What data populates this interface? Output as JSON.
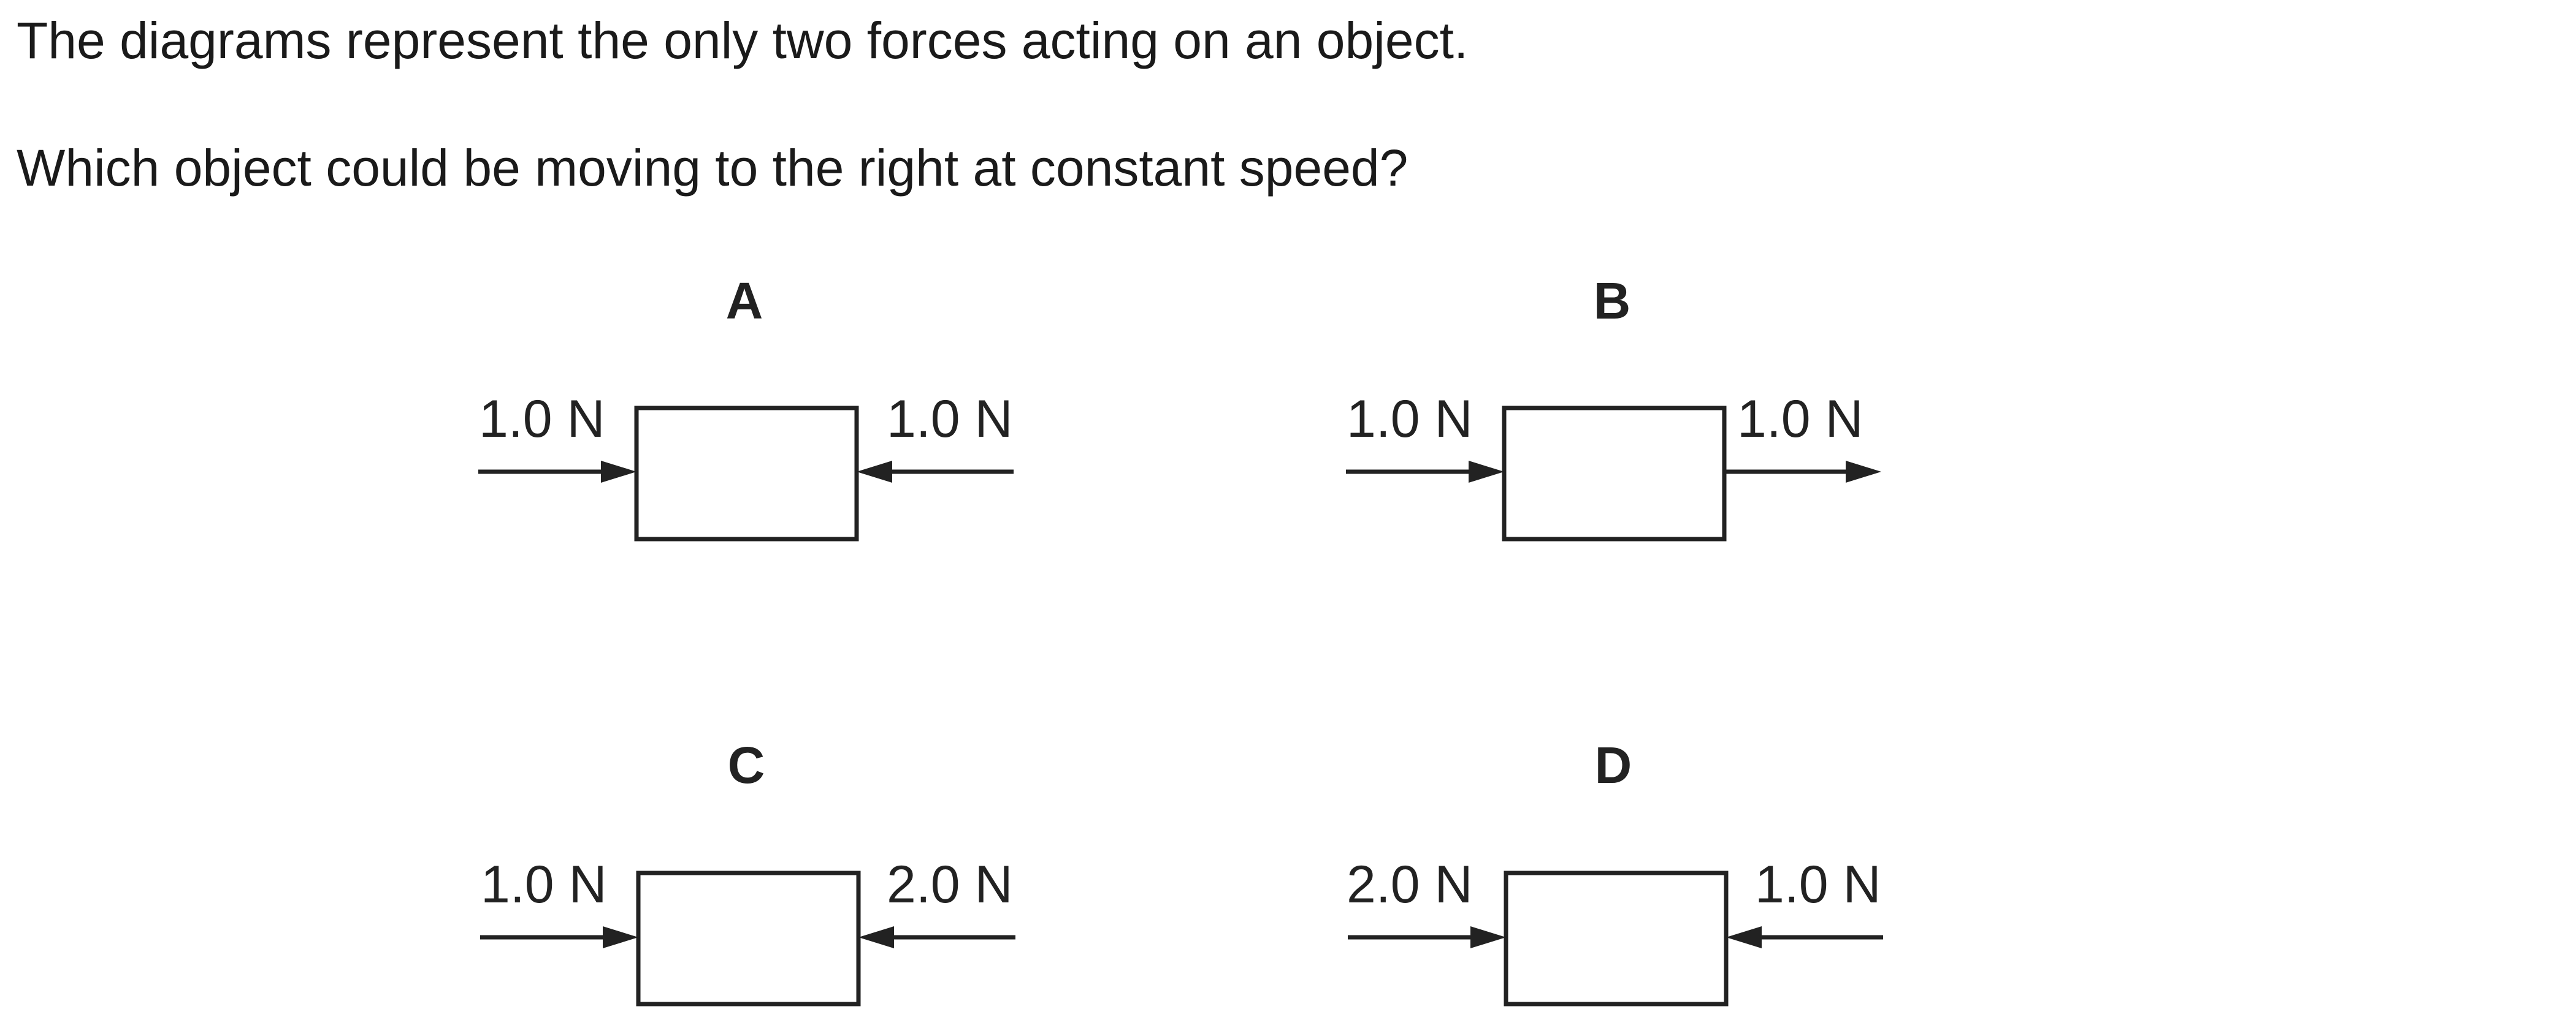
{
  "question": {
    "line1": "The diagrams represent the only two forces acting on an object.",
    "line2": "Which object could be moving to the right at constant speed?"
  },
  "options": [
    {
      "letter": "A",
      "left_force": {
        "label": "1.0 N",
        "direction": "right"
      },
      "right_force": {
        "label": "1.0 N",
        "direction": "left"
      }
    },
    {
      "letter": "B",
      "left_force": {
        "label": "1.0 N",
        "direction": "right"
      },
      "right_force": {
        "label": "1.0 N",
        "direction": "right"
      }
    },
    {
      "letter": "C",
      "left_force": {
        "label": "1.0 N",
        "direction": "right"
      },
      "right_force": {
        "label": "2.0 N",
        "direction": "left"
      }
    },
    {
      "letter": "D",
      "left_force": {
        "label": "2.0 N",
        "direction": "right"
      },
      "right_force": {
        "label": "1.0 N",
        "direction": "left"
      }
    }
  ],
  "colors": {
    "ink": "#222222"
  }
}
